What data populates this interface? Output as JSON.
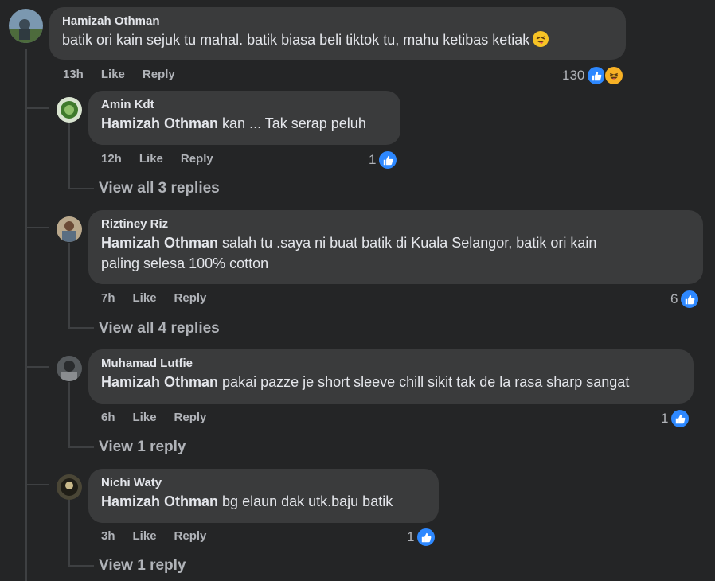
{
  "main_comment": {
    "author": "Hamizah Othman",
    "text": "batik ori kain sejuk tu mahal. batik biasa beli tiktok tu, mahu ketibas ketiak",
    "emoji": "grinning-squinting-tongue-emoji",
    "time": "13h",
    "like_label": "Like",
    "reply_label": "Reply",
    "reaction_count": "130"
  },
  "replies": [
    {
      "author": "Amin Kdt",
      "mention": "Hamizah Othman",
      "text": "kan ... Tak serap peluh",
      "time": "12h",
      "like_label": "Like",
      "reply_label": "Reply",
      "reaction_count": "1",
      "view_replies": "View all 3 replies"
    },
    {
      "author": "Riztiney Riz",
      "mention": "Hamizah Othman",
      "text": "salah tu .saya ni buat batik di Kuala Selangor, batik ori kain",
      "text2": "paling selesa 100% cotton",
      "time": "7h",
      "like_label": "Like",
      "reply_label": "Reply",
      "reaction_count": "6",
      "view_replies": "View all 4 replies"
    },
    {
      "author": "Muhamad Lutfie",
      "mention": "Hamizah Othman",
      "text": "pakai pazze je short sleeve chill sikit tak de la rasa sharp sangat",
      "time": "6h",
      "like_label": "Like",
      "reply_label": "Reply",
      "reaction_count": "1",
      "view_replies": "View 1 reply"
    },
    {
      "author": "Nichi Waty",
      "mention": "Hamizah Othman",
      "text": "bg elaun dak utk.baju batik",
      "time": "3h",
      "like_label": "Like",
      "reply_label": "Reply",
      "reaction_count": "1",
      "view_replies": "View 1 reply"
    }
  ],
  "colors": {
    "background": "#242526",
    "bubble": "#3a3b3c",
    "like_blue": "#2d88ff",
    "haha_yellow": "#f7b125",
    "secondary_text": "#b0b3b8"
  }
}
